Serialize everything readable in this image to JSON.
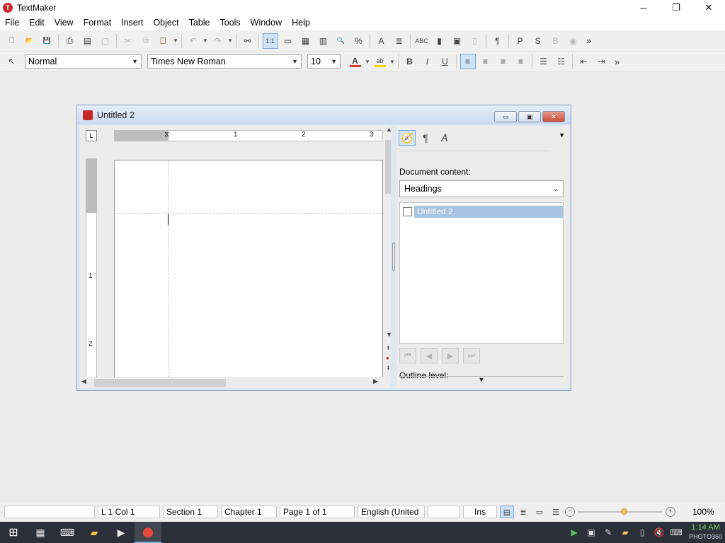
{
  "app": {
    "title": "TextMaker",
    "logo_letter": "T"
  },
  "window_controls": {
    "minimize": "─",
    "maximize": "❐",
    "close": "✕"
  },
  "menu": [
    "File",
    "Edit",
    "View",
    "Format",
    "Insert",
    "Object",
    "Table",
    "Tools",
    "Window",
    "Help"
  ],
  "toolbar1": {
    "overflow": "»",
    "buttons": [
      {
        "name": "new-document-icon",
        "glyph": "🗋",
        "state": "normal"
      },
      {
        "name": "open-folder-icon",
        "glyph": "📂",
        "state": "normal"
      },
      {
        "name": "save-icon",
        "glyph": "💾",
        "state": "normal"
      },
      {
        "name": "print-icon",
        "glyph": "⎙",
        "state": "normal"
      },
      {
        "name": "export-pdf-icon",
        "glyph": "▤",
        "state": "normal"
      },
      {
        "name": "print-preview-icon",
        "glyph": "▢",
        "state": "dim"
      },
      {
        "name": "cut-icon",
        "glyph": "✂",
        "state": "dim"
      },
      {
        "name": "copy-icon",
        "glyph": "⧉",
        "state": "dim"
      },
      {
        "name": "paste-icon",
        "glyph": "📋",
        "state": "dim"
      },
      {
        "name": "undo-icon",
        "glyph": "↶",
        "state": "dim"
      },
      {
        "name": "redo-icon",
        "glyph": "↷",
        "state": "dim"
      },
      {
        "name": "find-binoculars-icon",
        "glyph": "⚯",
        "state": "normal"
      },
      {
        "name": "view-full-page-icon",
        "glyph": "1:1",
        "state": "active"
      },
      {
        "name": "view-frame-icon",
        "glyph": "▭",
        "state": "normal"
      },
      {
        "name": "view-table-icon",
        "glyph": "▦",
        "state": "normal"
      },
      {
        "name": "view-columns-icon",
        "glyph": "▥",
        "state": "normal"
      },
      {
        "name": "zoom-icon",
        "glyph": "🔍",
        "state": "normal"
      },
      {
        "name": "zoom-percent-icon",
        "glyph": "%",
        "state": "normal"
      },
      {
        "name": "text-frame-icon",
        "glyph": "A",
        "state": "normal"
      },
      {
        "name": "field-icon",
        "glyph": "≣",
        "state": "normal"
      },
      {
        "name": "spellcheck-icon",
        "glyph": "ABC",
        "state": "normal"
      },
      {
        "name": "chart-icon",
        "glyph": "▮",
        "state": "normal"
      },
      {
        "name": "objects-icon",
        "glyph": "▣",
        "state": "normal"
      },
      {
        "name": "master-page-icon",
        "glyph": "▯",
        "state": "dim"
      },
      {
        "name": "pilcrow-icon",
        "glyph": "¶",
        "state": "normal"
      },
      {
        "name": "presentations-icon",
        "glyph": "P",
        "state": "normal"
      },
      {
        "name": "spreadsheet-icon",
        "glyph": "S",
        "state": "normal"
      },
      {
        "name": "basic-icon",
        "glyph": "B",
        "state": "dim"
      },
      {
        "name": "planmaker-icon",
        "glyph": "◉",
        "state": "dim"
      }
    ]
  },
  "toolbar2": {
    "overflow": "»",
    "style_value": "Normal",
    "font_value": "Times New Roman",
    "size_value": "10",
    "format_buttons": [
      {
        "name": "bold-icon",
        "glyph": "B",
        "state": "normal"
      },
      {
        "name": "italic-icon",
        "glyph": "I",
        "state": "normal"
      },
      {
        "name": "underline-icon",
        "glyph": "U",
        "state": "normal"
      },
      {
        "name": "align-left-icon",
        "glyph": "≡",
        "state": "active"
      },
      {
        "name": "align-center-icon",
        "glyph": "≡",
        "state": "normal"
      },
      {
        "name": "align-right-icon",
        "glyph": "≡",
        "state": "normal"
      },
      {
        "name": "align-justify-icon",
        "glyph": "≡",
        "state": "normal"
      },
      {
        "name": "bullet-list-icon",
        "glyph": "☰",
        "state": "normal"
      },
      {
        "name": "numbered-list-icon",
        "glyph": "☷",
        "state": "normal"
      },
      {
        "name": "decrease-indent-icon",
        "glyph": "⇤",
        "state": "normal"
      },
      {
        "name": "increase-indent-icon",
        "glyph": "⇥",
        "state": "normal"
      }
    ],
    "font_color": "#d83a2e",
    "highlight_color": "#f5d300"
  },
  "document": {
    "title": "Untitled 2",
    "ruler_numbers": [
      "1",
      "2",
      "3"
    ],
    "vruler_numbers": [
      "1",
      "2"
    ]
  },
  "doc_controls": {
    "minimize": "▭",
    "maximize": "▣",
    "close": "✕"
  },
  "sidebar": {
    "content_label": "Document content:",
    "content_value": "Headings",
    "tree_items": [
      "Untitled 2"
    ],
    "outline_label": "Outline level:"
  },
  "statusbar": {
    "blank": "",
    "position": "L 1 Col 1",
    "section": "Section 1",
    "chapter": "Chapter 1",
    "page": "Page 1 of 1",
    "language": "English (United",
    "empty": "",
    "mode": "Ins",
    "zoom": "100%",
    "zoom_level_fraction": 0.55
  },
  "taskbar": {
    "clock": "1:14 AM",
    "watermark": "PHOTO360"
  }
}
